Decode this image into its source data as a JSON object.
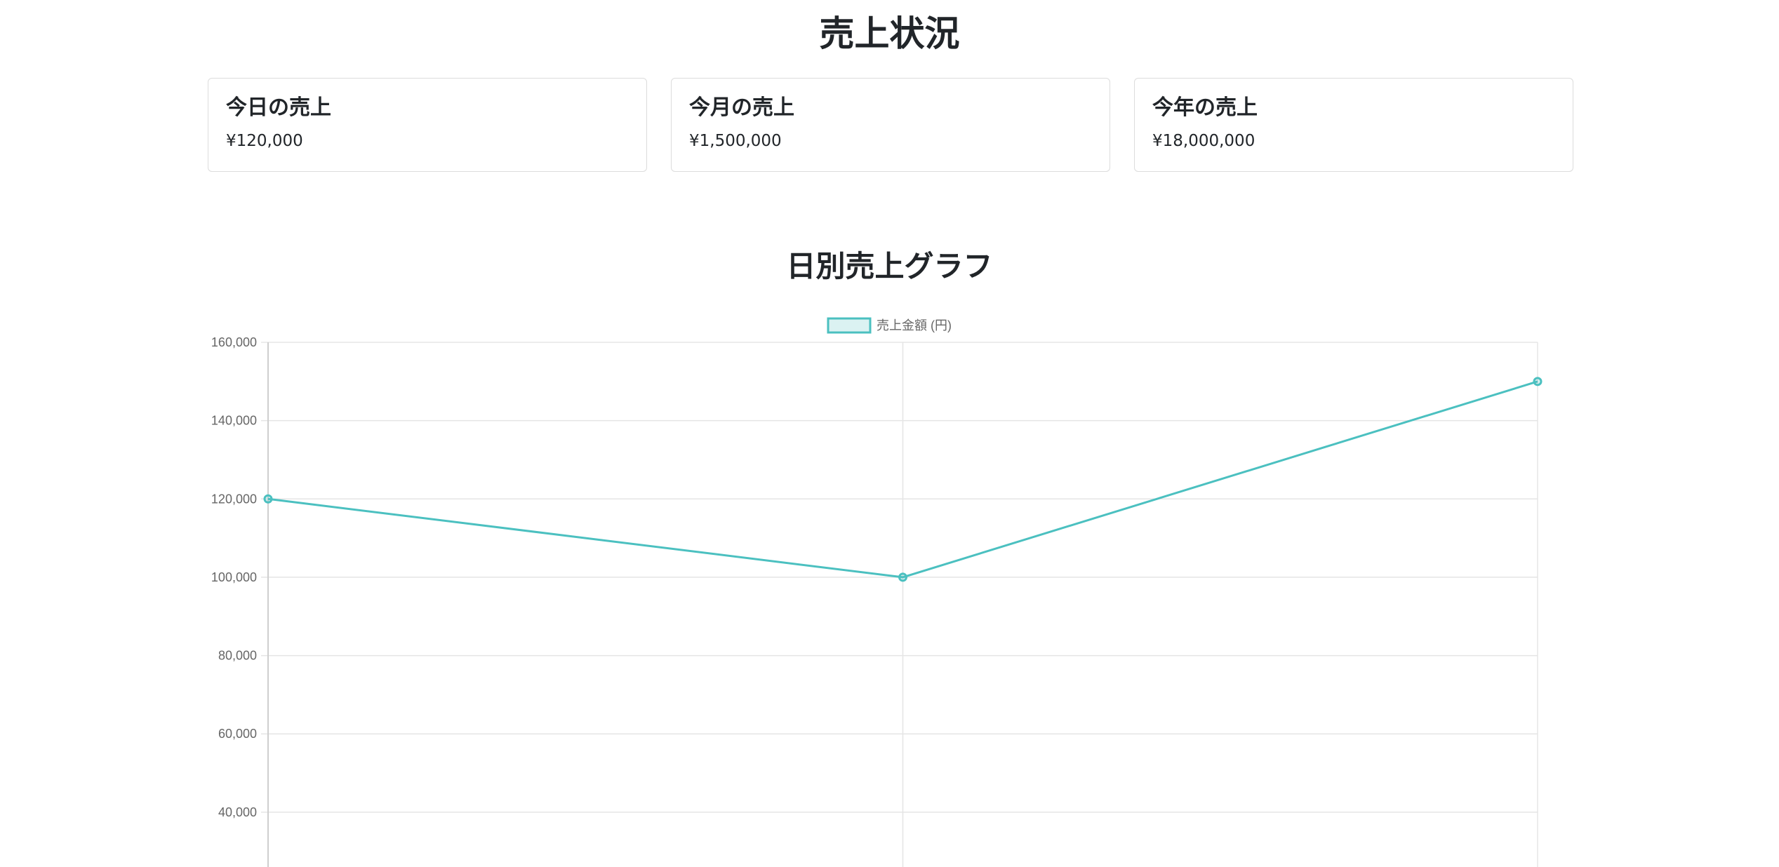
{
  "page": {
    "title": "売上状況"
  },
  "cards": [
    {
      "title": "今日の売上",
      "value": "¥120,000"
    },
    {
      "title": "今月の売上",
      "value": "¥1,500,000"
    },
    {
      "title": "今年の売上",
      "value": "¥18,000,000"
    }
  ],
  "chart_section": {
    "title": "日別売上グラフ"
  },
  "colors": {
    "line": "#4bc0c0",
    "fill": "rgba(75,192,192,0.2)",
    "grid": "#e5e5e5",
    "tick": "#666666"
  },
  "chart_data": {
    "type": "line",
    "title": "",
    "xlabel": "",
    "ylabel": "",
    "categories": [
      "",
      "",
      ""
    ],
    "series": [
      {
        "name": "売上金額 (円)",
        "values": [
          120000,
          100000,
          150000
        ]
      }
    ],
    "ylim": [
      26000,
      160000
    ],
    "yticks": [
      160000,
      140000,
      120000,
      100000,
      80000,
      60000,
      40000
    ],
    "ytick_labels": [
      "160,000",
      "140,000",
      "120,000",
      "100,000",
      "80,000",
      "60,000",
      "40,000"
    ],
    "grid": true,
    "legend": "top"
  }
}
